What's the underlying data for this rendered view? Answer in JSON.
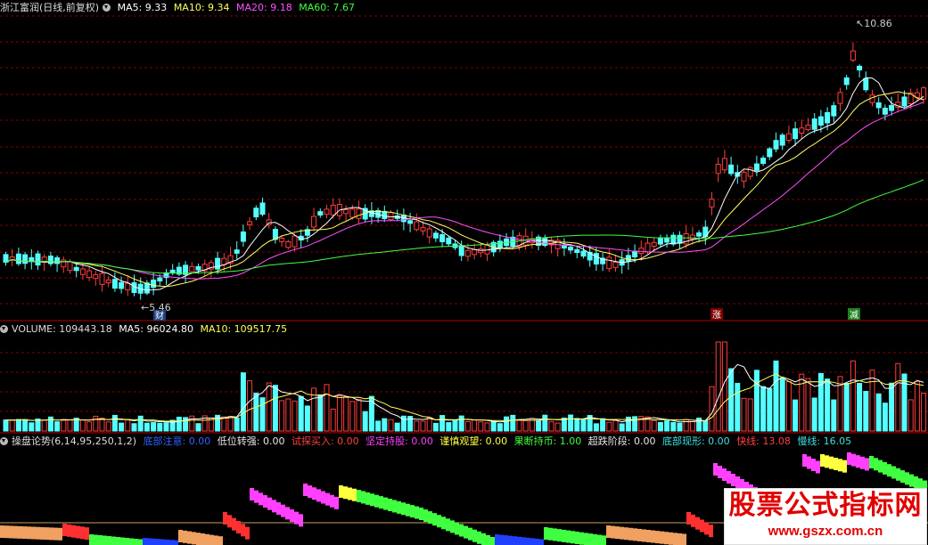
{
  "stock": {
    "name": "浙江富润(日线,前复权)",
    "ma5": "MA5: 9.33",
    "ma10": "MA10: 9.34",
    "ma20": "MA20: 9.18",
    "ma60": "MA60: 7.67",
    "high_label": "10.86",
    "low_label": "5.46",
    "marker_cai": "财",
    "marker_zhang": "涨",
    "marker_jian": "减"
  },
  "volume": {
    "label": "VOLUME: 109443.18",
    "ma5": "MA5: 96024.80",
    "ma10": "MA10: 109517.75"
  },
  "indicator": {
    "name": "操盘论势(6,14,95,250,1,2)",
    "items": [
      {
        "label": "底部注意: 0.00",
        "color": "#3060ff"
      },
      {
        "label": "低位转强: 0.00",
        "color": "#e8e8e8"
      },
      {
        "label": "试探买入: 0.00",
        "color": "#ff4040"
      },
      {
        "label": "坚定持股: 0.00",
        "color": "#ff40ff"
      },
      {
        "label": "谨慎观望: 0.00",
        "color": "#ffff40"
      },
      {
        "label": "果断持币: 1.00",
        "color": "#40ff40"
      },
      {
        "label": "超跌阶段: 0.00",
        "color": "#e8e8e8"
      },
      {
        "label": "底部现形: 0.00",
        "color": "#40e0e0"
      },
      {
        "label": "快线: 13.08",
        "color": "#ff4040"
      },
      {
        "label": "慢线: 16.05",
        "color": "#40e0e0"
      }
    ]
  },
  "watermark": {
    "title": "股票公式指标网",
    "url": "www.gszx.com.cn"
  },
  "colors": {
    "up": "#ff3c3c",
    "down": "#54ffff",
    "ma5": "#ffffff",
    "ma10": "#ffff60",
    "ma20": "#ff50ff",
    "ma60": "#40ff40",
    "grid": "#800000"
  }
}
